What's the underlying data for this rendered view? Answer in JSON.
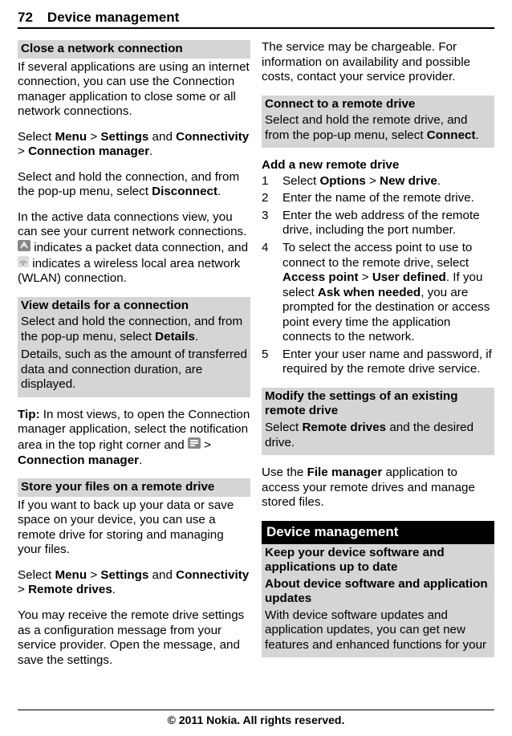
{
  "header": {
    "pageNumber": "72",
    "title": "Device management"
  },
  "left": {
    "s1": {
      "title": "Close a network connection"
    },
    "p1a": "If several applications are using an internet connection, you can use the Connection manager application to close some or all network connections.",
    "p1b_pre": "Select ",
    "p1b_menu": "Menu",
    "p1b_gt1": " > ",
    "p1b_settings": "Settings",
    "p1b_and": " and ",
    "p1b_conn": "Connectivity",
    "p1b_gt2": " > ",
    "p1b_cm": "Connection manager",
    "p1b_dot": ".",
    "p1c_pre": "Select and hold the connection, and from the pop-up menu, select ",
    "p1c_bold": "Disconnect",
    "p1c_post": ".",
    "p1d_pre": "In the active data connections view, you can see your current network connections. ",
    "p1d_mid": " indicates a packet data connection, and ",
    "p1d_post": " indicates a wireless local area network (WLAN) connection.",
    "s2": {
      "title": "View details for a connection",
      "body_pre": "Select and hold the connection, and from the pop-up menu, select ",
      "body_bold": "Details",
      "body_post": ".",
      "body2": "Details, such as the amount of transferred data and connection duration, are displayed."
    },
    "tip_pre": "Tip: ",
    "tip_body": "In most views, to open the Connection manager application, select the notification area in the top right corner and ",
    "tip_gt": " > ",
    "tip_cm": "Connection manager",
    "tip_dot": ".",
    "s3": {
      "title": "Store your files on a remote drive"
    },
    "p3a": "If you want to back up your data or save space on your device, you can use a remote drive for storing and managing your files.",
    "p3b_pre": "Select ",
    "p3b_menu": "Menu",
    "p3b_gt1": " > ",
    "p3b_settings": "Settings",
    "p3b_and": " and ",
    "p3b_conn": "Connectivity",
    "p3b_gt2": " > ",
    "p3b_rd": "Remote drives",
    "p3b_dot": ".",
    "p3c": "You may receive the remote drive settings as a configuration message from your service provider. Open the message, and save the settings."
  },
  "right": {
    "p1": "The service may be chargeable. For information on availability and possible costs, contact your service provider.",
    "s1": {
      "title": "Connect to a remote drive",
      "body_pre": "Select and hold the remote drive, and from the pop-up menu, select ",
      "body_bold": "Connect",
      "body_post": "."
    },
    "addTitle": "Add a new remote drive",
    "steps": {
      "s1_pre": "Select ",
      "s1_opt": "Options",
      "s1_gt": " > ",
      "s1_new": "New drive",
      "s1_dot": ".",
      "s2": "Enter the name of the remote drive.",
      "s3": "Enter the web address of the remote drive, including the port number.",
      "s4_pre": "To select the access point to use to connect to the remote drive, select ",
      "s4_ap": "Access point",
      "s4_gt": " > ",
      "s4_ud": "User defined",
      "s4_mid": ". If you select ",
      "s4_awn": "Ask when needed",
      "s4_post": ", you are prompted for the destination or access point every time the application connects to the network.",
      "s5": "Enter your user name and password, if required by the remote drive service."
    },
    "s2": {
      "title": "Modify the settings of an existing remote drive",
      "body_pre": "Select ",
      "body_bold": "Remote drives",
      "body_post": " and the desired drive."
    },
    "p2_pre": "Use the ",
    "p2_bold": "File manager",
    "p2_post": " application to access your remote drives and manage stored files.",
    "black": "Device management",
    "s3": {
      "title": "Keep your device software and applications up to date",
      "sub": "About device software and application updates",
      "body": "With device software updates and application updates, you can get new features and enhanced functions for your"
    }
  },
  "footer": "© 2011 Nokia. All rights reserved."
}
